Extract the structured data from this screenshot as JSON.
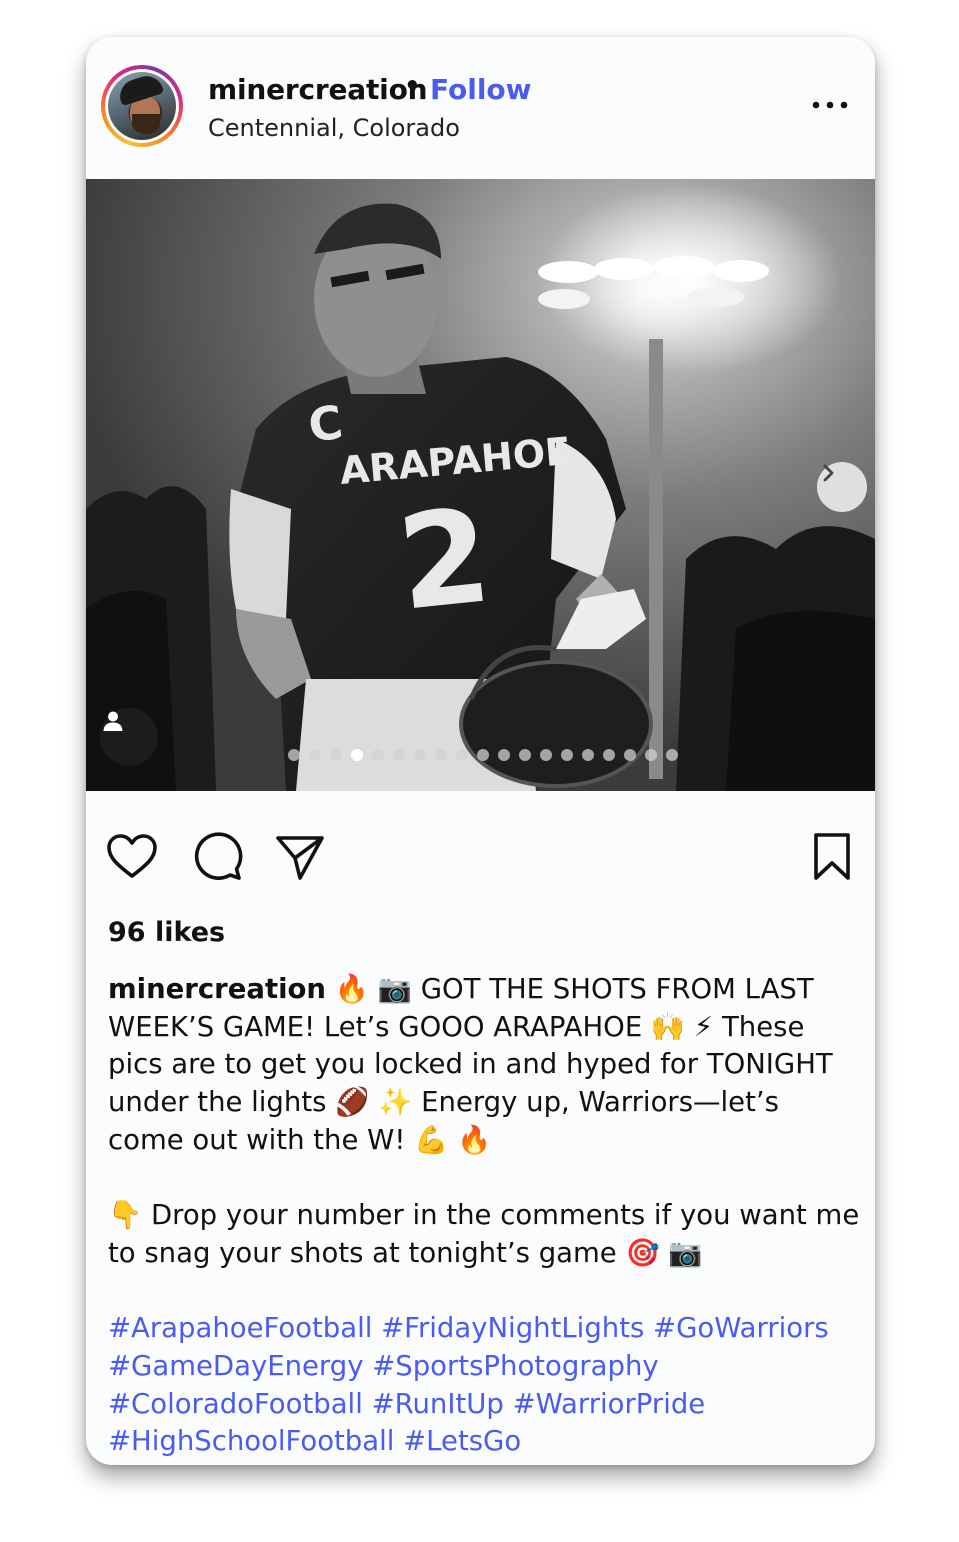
{
  "post": {
    "username": "minercreation",
    "separator": "•",
    "follow_label": "Follow",
    "location": "Centennial, Colorado",
    "image_alt": "Black and white photo of an Arapahoe football player wearing jersey number 2 under stadium lights",
    "jersey_text": "ARAPAHOE",
    "jersey_number": "2",
    "jersey_letter": "C",
    "carousel": {
      "total": 19,
      "active_index": 3
    },
    "likes": "96 likes",
    "caption": {
      "username": "minercreation",
      "line1": "🔥 📷 GOT THE SHOTS FROM LAST WEEK’S GAME! Let’s GOOO ARAPAHOE 🙌 ⚡ These pics are to get you locked in and hyped for TONIGHT under the lights 🏈 ✨ Energy up, Warriors—let’s come out with the W! 💪 🔥",
      "line2": "👇 Drop your number in the comments if you want me to snag your shots at tonight’s game 🎯 📷",
      "hashtags": "#ArapahoeFootball #FridayNightLights #GoWarriors #GameDayEnergy #SportsPhotography #ColoradoFootball #RunItUp #WarriorPride #HighSchoolFootball #LetsGo"
    }
  },
  "icons": {
    "more": "more-horizontal-icon",
    "next": "chevron-right-icon",
    "tag": "person-tag-icon",
    "like": "heart-icon",
    "comment": "comment-icon",
    "share": "send-icon",
    "save": "bookmark-icon"
  },
  "colors": {
    "link": "#4a5cf0",
    "text": "#111111",
    "card": "#fbfcfe"
  }
}
